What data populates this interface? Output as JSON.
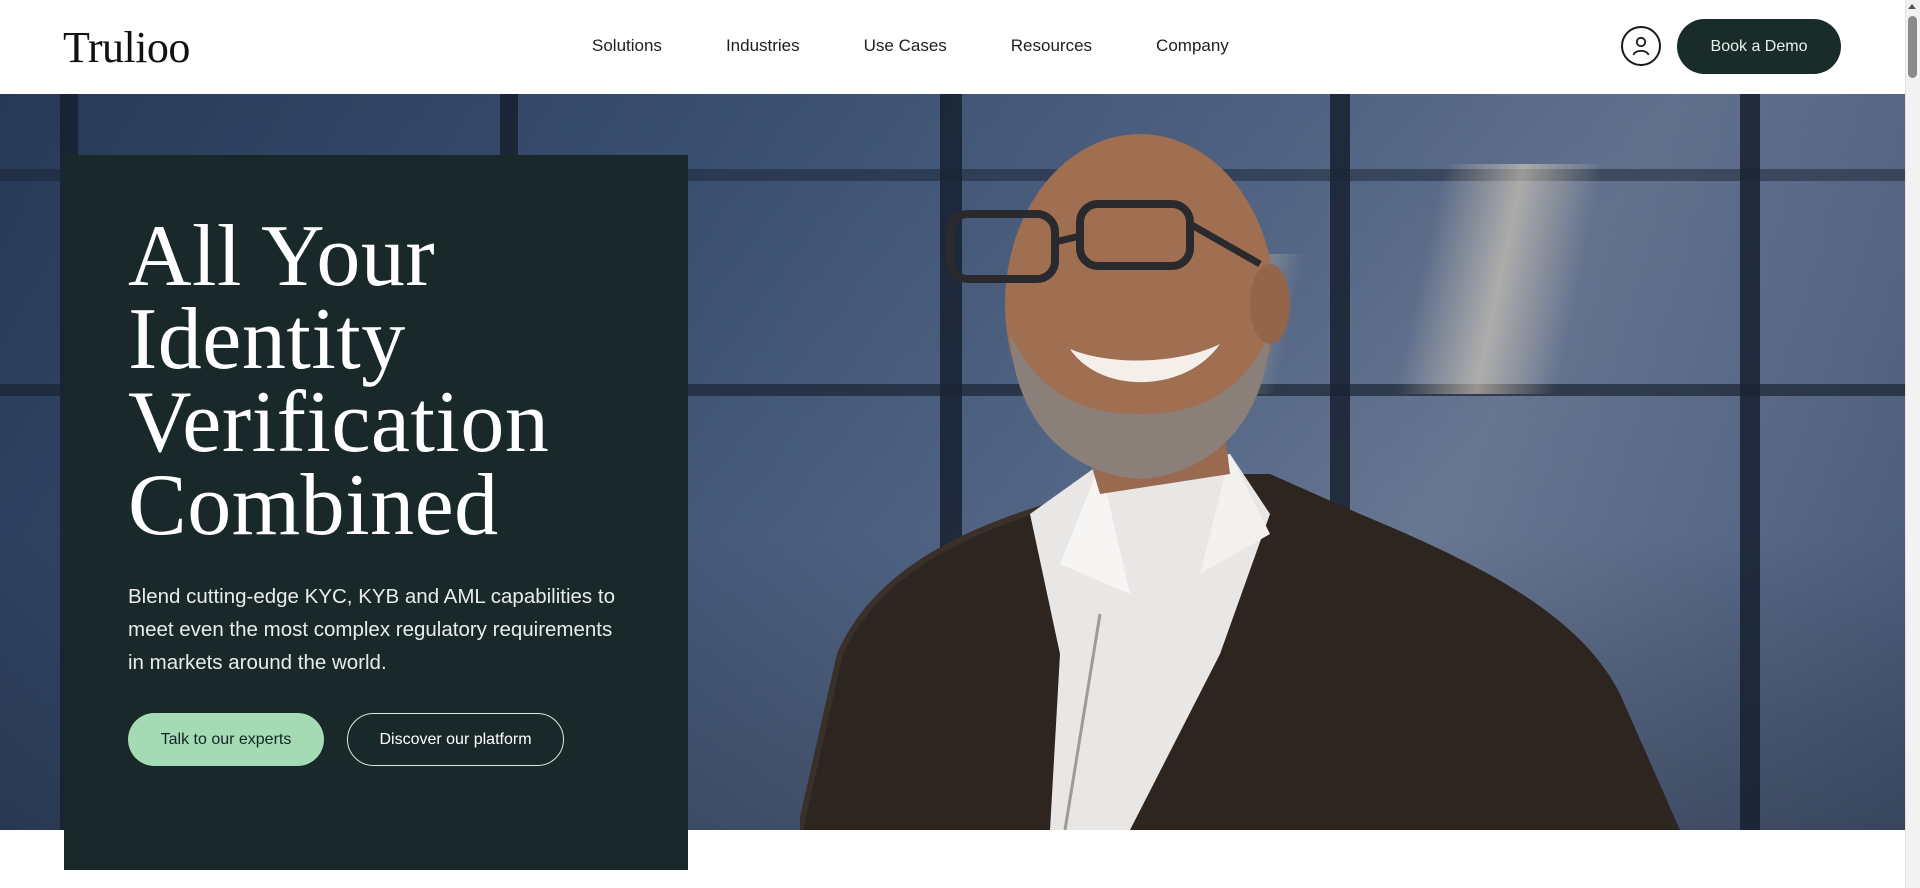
{
  "brand": {
    "logo_text": "Trulioo"
  },
  "nav": {
    "items": [
      {
        "label": "Solutions"
      },
      {
        "label": "Industries"
      },
      {
        "label": "Use Cases"
      },
      {
        "label": "Resources"
      },
      {
        "label": "Company"
      }
    ]
  },
  "header_actions": {
    "account_icon": "user-icon",
    "demo_label": "Book a Demo"
  },
  "hero": {
    "headline_lines": [
      "All Your",
      "Identity",
      "Verification",
      "Combined"
    ],
    "subtext": "Blend cutting-edge KYC, KYB and AML capabilities to meet even the most complex regulatory requirements in markets around the world.",
    "primary_cta": "Talk to our experts",
    "secondary_cta": "Discover our platform"
  },
  "colors": {
    "panel_bg": "#19292a",
    "demo_button_bg": "#1a2c29",
    "primary_cta_bg": "#a4dbb5",
    "page_bg": "#ffffff"
  }
}
